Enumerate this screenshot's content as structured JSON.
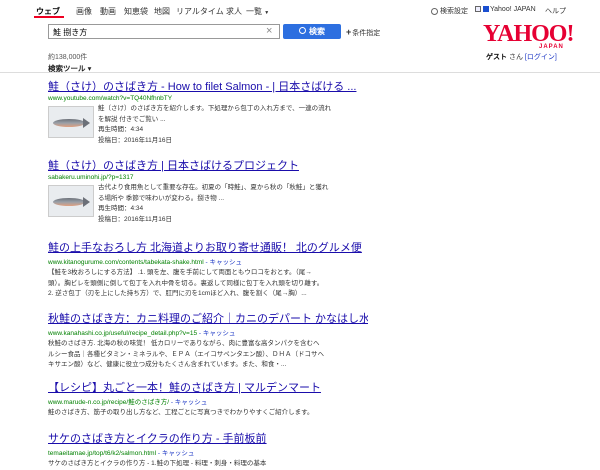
{
  "nav": {
    "tabs": [
      "ウェブ",
      "画像",
      "動画",
      "知恵袋",
      "地図",
      "リアルタイム",
      "求人",
      "一覧"
    ],
    "more_arrow": "▼",
    "settings": "検索設定",
    "yahoo_japan": "Yahoo! JAPAN",
    "help": "ヘルプ"
  },
  "logo": {
    "main": "YAHOO!",
    "sub": "JAPAN"
  },
  "search": {
    "query": "鮭 捌き方",
    "clear": "×",
    "button": "検索",
    "condition": "条件指定"
  },
  "count": "約138,000件",
  "guest": {
    "name": "ゲスト",
    "suffix": "さん",
    "login": "[ログイン]"
  },
  "tools": "検索ツール ▾",
  "results": [
    {
      "title": "鮭（さけ）のさばき方 - How to filet Salmon - | 日本さばける ...",
      "url": "www.youtube.com/watch?v=TQ40NfhnbTY",
      "desc1": "鮭（さけ）のさばき方を紹介します。下処理から包丁の入れ方まで、一連の流れ",
      "desc2": "を解説 付きでご覧い ...",
      "duration": "再生時間：4:34",
      "posted": "投稿日：2016年11月16日"
    },
    {
      "title": "鮭（さけ）のさばき方 | 日本さばけるプロジェクト",
      "url": "sabakeru.uminohi.jp/?p=1317",
      "desc1": "古代より食用魚として重要な存在。初夏の「時鮭」、夏から秋の「秋鮭」と獲れ",
      "desc2": "る場所や 季節で味わいが変わる。捌き物 ...",
      "duration": "再生時間：4:34",
      "posted": "投稿日：2016年11月16日"
    },
    {
      "title": "鮭の上手なおろし方 北海道よりお取り寄せ通販！ 北のグルメ便",
      "url": "www.kitanogurume.com/contents/tabekata-shake.html",
      "cache": "- キャッシュ",
      "desc1": "【鮭を3枚おろしにする方法】 .1. 頭を左、腹を手前にして両面ともウロコをおとす。（尾→",
      "desc2": "頭）。胸ビレを頭側に倒して包丁を入れ中骨を切る。裏返して同様に包丁を入れ頭を切り離す。",
      "desc3": "2. 逆さ包丁（刃を上にした持ち方）で、肛門に刃を1cmほど入れ、腹を割く（尾→胸）..."
    },
    {
      "title": "秋鮭のさばき方：カニ料理のご紹介｜カニのデパート かなはし水産",
      "url": "www.kanahashi.co.jp/useful/recipe_detail.php?v=15",
      "cache": "- キャッシュ",
      "desc1": "秋鮭のさばき方. 北海の秋の味覚！ 低カロリーでありながら、肉に豊富な高タンパクを含むヘ",
      "desc2": "ルシー食品｜各種ビタミン・ミネラルや、ＥＰＡ（エイコサペンタエン酸）、ＤＨＡ（ドコサヘ",
      "desc3": "キサエン酸）など、健康に役立つ成分もたくさん含まれています。また、和食・..."
    },
    {
      "title": "【レシピ】丸ごと一本！鮭のさばき方 | マルデンマート",
      "url": "www.marude-n.co.jp/recipe/鮭のさばき方/",
      "cache": "- キャッシュ",
      "desc1": "鮭のさばき方、筋子の取り出し方など、工程ごとに写真つきでわかりやすくご紹介します。"
    },
    {
      "title": "サケのさばき方とイクラの作り方 - 手前板前",
      "url": "temaeitamae.jp/top/t6/k2/salmon.html",
      "cache": "- キャッシュ",
      "desc1": "サケのさばき方とイクラの作り方 - 1.鮭の下処理 - 料理・刺身・料理の基本"
    }
  ]
}
